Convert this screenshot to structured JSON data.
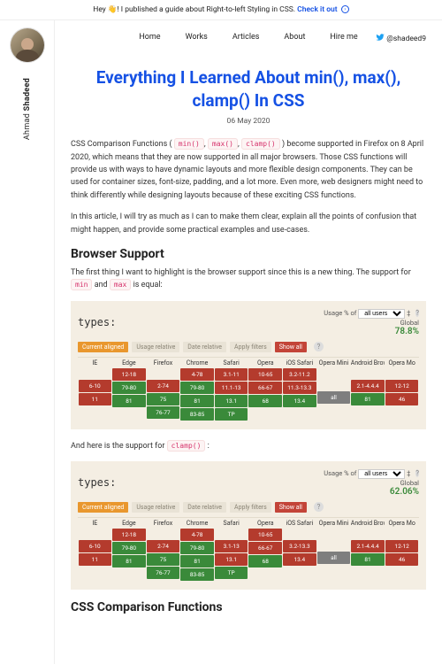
{
  "announce": {
    "prefix": "Hey 👋! I published a guide about Right-to-left Styling in CSS.",
    "link_label": "Check it out"
  },
  "author": {
    "first": "Ahmad",
    "last": "Shadeed"
  },
  "nav": {
    "home": "Home",
    "works": "Works",
    "articles": "Articles",
    "about": "About",
    "hire": "Hire me",
    "twitter_handle": "@shadeed9"
  },
  "post": {
    "title": "Everything I Learned About min(), max(), clamp() In CSS",
    "date": "06 May 2020",
    "intro_before": "CSS Comparison Functions (",
    "intro_code1": "min()",
    "intro_code2": "max()",
    "intro_code3": "clamp()",
    "intro_after": ") become supported in Firefox on 8 April 2020, which means that they are now supported in all major browsers. Those CSS functions will provide us with ways to have dynamic layouts and more flexible design components. They can be used for container sizes, font-size, padding, and a lot more. Even more, web designers might need to think differently while designing layouts because of these exciting CSS functions.",
    "intro2": "In this article, I will try as much as I can to make them clear, explain all the points of confusion that might happen, and provide some practical examples and use-cases.",
    "h_browser": "Browser Support",
    "p_browser": "The first thing I want to highlight is the browser support since this is a new thing. The support for",
    "p_browser_mid": "and",
    "p_browser_end": "is equal:",
    "code_min": "min",
    "code_max": "max",
    "p_clamp_pre": "And here is the support for",
    "code_clamp": "clamp()",
    "p_clamp_post": ":",
    "h_compare": "CSS Comparison Functions"
  },
  "caniuse_tabs": {
    "current": "Current aligned",
    "usage": "Usage relative",
    "date": "Date relative",
    "apply": "Apply filters",
    "show": "Show all"
  },
  "usage_label": "Usage % of",
  "usage_select": "all users",
  "global_label": "Global",
  "chart_data": [
    {
      "type": "table",
      "title": "types: <min()>",
      "global_pct": "78.8%",
      "browsers": [
        "IE",
        "Edge",
        "Firefox",
        "Chrome",
        "Safari",
        "Opera",
        "iOS Safari",
        "Opera Mini",
        "Android Browser",
        "Opera Mo"
      ],
      "rows": [
        [
          null,
          "12-18",
          null,
          "4-78",
          "3.1-11",
          "10-65",
          "3.2-11.2",
          null,
          null,
          null
        ],
        [
          "6-10",
          "79-80",
          "2-74",
          "79-80",
          "11.1-13",
          "66-67",
          "11.3-13.3",
          null,
          "2.1-4.4.4",
          "12-12"
        ],
        [
          "11",
          "81",
          "75",
          "81",
          "13.1",
          "68",
          "13.4",
          "all",
          "81",
          "46"
        ],
        [
          null,
          null,
          "76-77",
          "83-85",
          "TP",
          null,
          null,
          null,
          null,
          null
        ]
      ],
      "row_colors": [
        [
          null,
          "red",
          null,
          "red",
          "red",
          "red",
          "red",
          null,
          null,
          null
        ],
        [
          "red",
          "green",
          "red",
          "green",
          "red",
          "red",
          "red",
          null,
          "red",
          "red"
        ],
        [
          "red",
          "green",
          "green",
          "green",
          "green",
          "green",
          "green",
          "dark",
          "green",
          "red"
        ],
        [
          null,
          null,
          "green",
          "green",
          "green",
          null,
          null,
          null,
          null,
          null
        ]
      ]
    },
    {
      "type": "table",
      "title": "types: <clamp()>",
      "global_pct": "62.06%",
      "browsers": [
        "IE",
        "Edge",
        "Firefox",
        "Chrome",
        "Safari",
        "Opera",
        "iOS Safari",
        "Opera Mini",
        "Android Browser",
        "Opera Mo"
      ],
      "rows": [
        [
          null,
          "12-18",
          null,
          "4-78",
          null,
          "10-65",
          null,
          null,
          null,
          null
        ],
        [
          "6-10",
          "79-80",
          "2-74",
          "79-80",
          "3.1-13",
          "66-67",
          "3.2-13.3",
          null,
          "2.1-4.4.4",
          "12-12"
        ],
        [
          "11",
          "81",
          "75",
          "81",
          "13.1",
          "68",
          "13.4",
          "all",
          "81",
          "46"
        ],
        [
          null,
          null,
          "76-77",
          "83-85",
          "TP",
          null,
          null,
          null,
          null,
          null
        ]
      ],
      "row_colors": [
        [
          null,
          "red",
          null,
          "red",
          null,
          "red",
          null,
          null,
          null,
          null
        ],
        [
          "red",
          "green",
          "red",
          "green",
          "red",
          "red",
          "red",
          null,
          "red",
          "red"
        ],
        [
          "red",
          "green",
          "green",
          "green",
          "red",
          "green",
          "red",
          "dark",
          "green",
          "red"
        ],
        [
          null,
          null,
          "green",
          "green",
          "green",
          null,
          null,
          null,
          null,
          null
        ]
      ]
    }
  ]
}
